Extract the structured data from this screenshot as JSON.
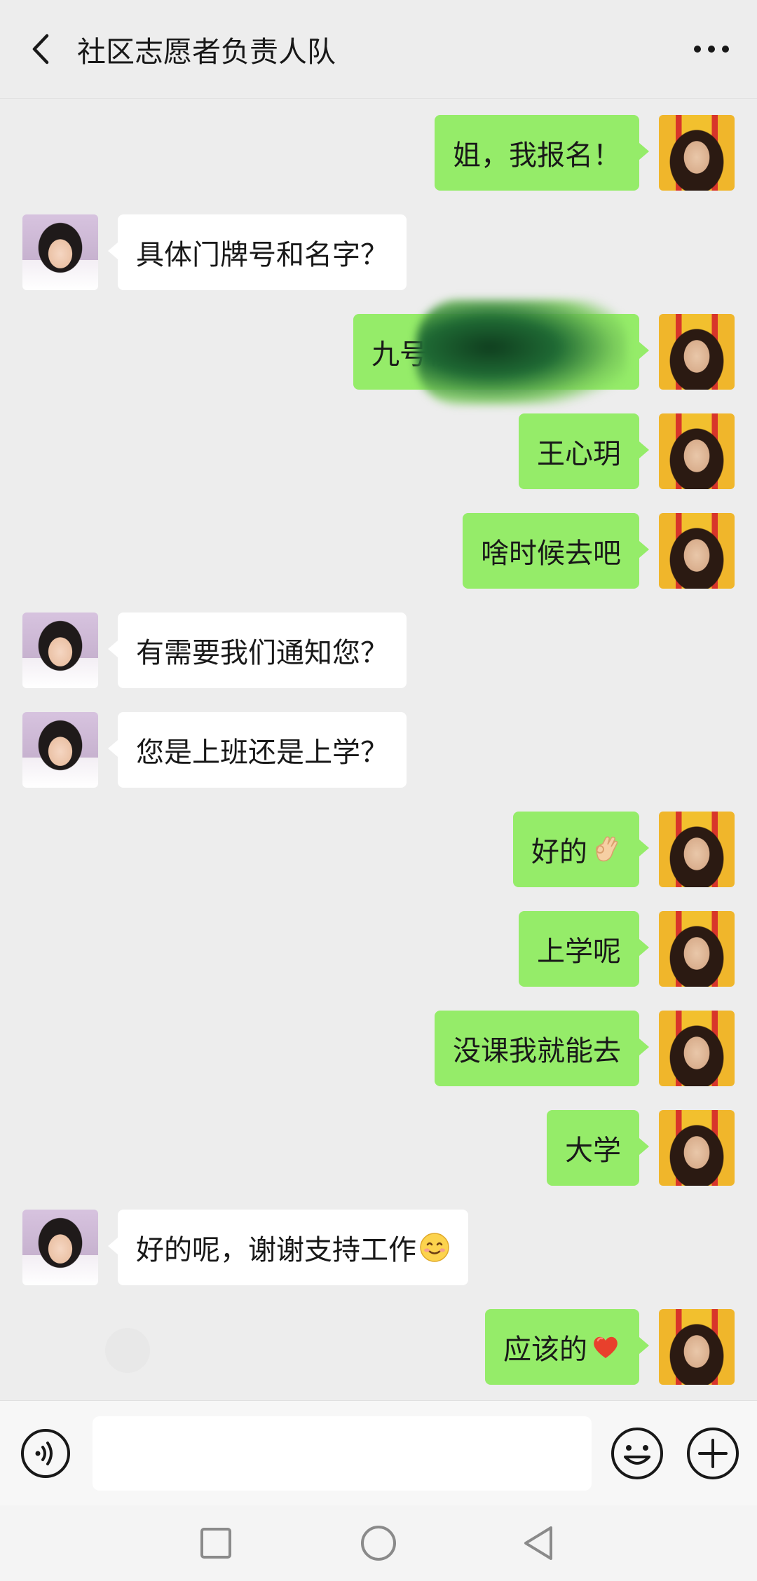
{
  "header": {
    "title": "社区志愿者负责人队",
    "back_icon": "chevron-left-icon",
    "more_icon": "more-dots-icon"
  },
  "colors": {
    "background": "#ededed",
    "self_bubble": "#95ec69",
    "other_bubble": "#ffffff"
  },
  "messages": [
    {
      "side": "right",
      "text": "姐，我报名！"
    },
    {
      "side": "left",
      "text": "具体门牌号和名字？"
    },
    {
      "side": "right",
      "text": "九号楼一",
      "redacted": true
    },
    {
      "side": "right",
      "text": "王心玥"
    },
    {
      "side": "right",
      "text": "啥时候去吧"
    },
    {
      "side": "left",
      "text": "有需要我们通知您？"
    },
    {
      "side": "left",
      "text": "您是上班还是上学？"
    },
    {
      "side": "right",
      "text": "好的",
      "emoji": "ok-hand-emoji"
    },
    {
      "side": "right",
      "text": "上学呢"
    },
    {
      "side": "right",
      "text": "没课我就能去"
    },
    {
      "side": "right",
      "text": "大学"
    },
    {
      "side": "left",
      "text": "好的呢，谢谢支持工作",
      "emoji": "smiling-face-emoji"
    },
    {
      "side": "right",
      "text": "应该的",
      "emoji": "red-heart-emoji"
    }
  ],
  "input_bar": {
    "voice_icon": "voice-icon",
    "text_value": "",
    "emoji_icon": "emoji-icon",
    "plus_icon": "plus-icon"
  },
  "nav_bar": {
    "recents_icon": "square-icon",
    "home_icon": "circle-icon",
    "back_icon": "triangle-back-icon"
  }
}
